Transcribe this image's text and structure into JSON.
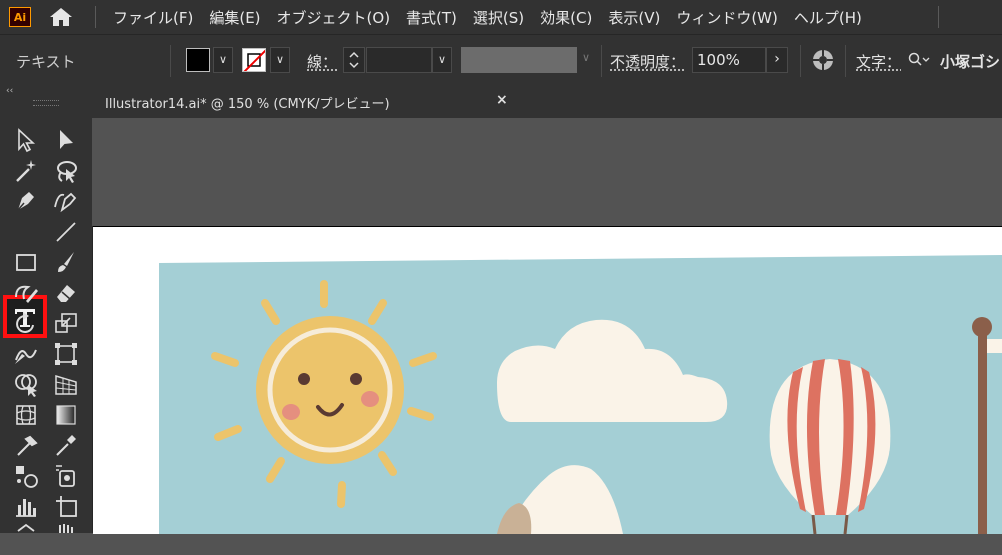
{
  "app": {
    "logo_text": "Ai"
  },
  "menu": [
    "ファイル(F)",
    "編集(E)",
    "オブジェクト(O)",
    "書式(T)",
    "選択(S)",
    "効果(C)",
    "表示(V)",
    "ウィンドウ(W)",
    "ヘルプ(H)"
  ],
  "control_bar": {
    "context_label": "テキスト",
    "stroke_label": "線：",
    "opacity_label": "不透明度：",
    "opacity_value": "100%",
    "char_label": "文字：",
    "font_value": "小塚ゴシ"
  },
  "document": {
    "tab_title": "Illustrator14.ai* @ 150 % (CMYK/プレビュー)",
    "close_symbol": "×"
  },
  "toolbox": {
    "collapse_symbol": "‹‹",
    "selected_tool": "type-tool",
    "highlight_color": "#ff1010"
  },
  "colors": {
    "sky": "#a4cfd5",
    "sun": "#ecc46b",
    "cloud": "#faf3e8",
    "balloon_red": "#dd7261",
    "ui_dark": "#323232"
  }
}
